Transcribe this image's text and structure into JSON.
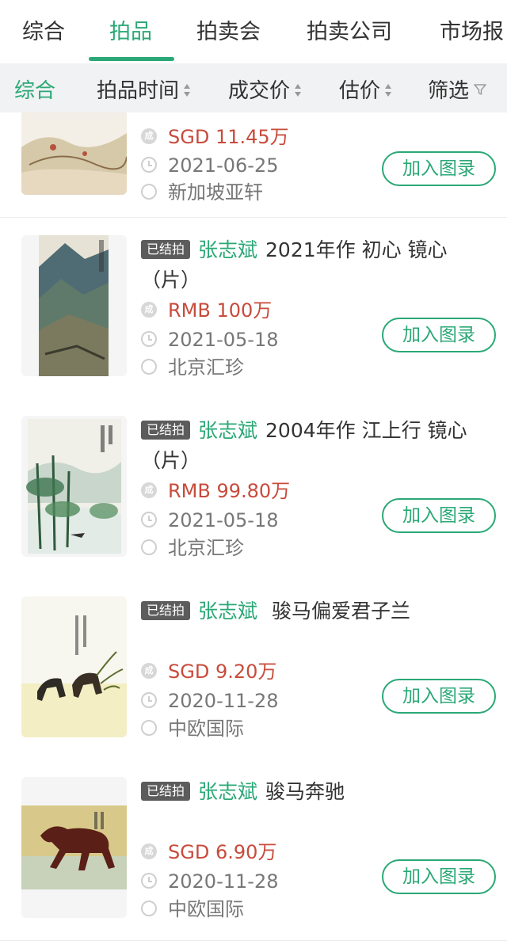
{
  "tabs": [
    "综合",
    "拍品",
    "拍卖会",
    "拍卖公司",
    "市场报"
  ],
  "filters": {
    "all": "综合",
    "time": "拍品时间",
    "deal_price": "成交价",
    "estimate": "估价",
    "filter": "筛选"
  },
  "badge_price_glyph": "成",
  "items": [
    {
      "badge": "",
      "artist": "",
      "title": "",
      "price": "SGD 11.45万",
      "date": "2021-06-25",
      "house": "新加坡亚轩",
      "button": "加入图录"
    },
    {
      "badge": "已结拍",
      "artist": "张志斌",
      "title": "2021年作 初心 镜心（片）",
      "price": "RMB 100万",
      "date": "2021-05-18",
      "house": "北京汇珍",
      "button": "加入图录"
    },
    {
      "badge": "已结拍",
      "artist": "张志斌",
      "title": "2004年作 江上行 镜心（片）",
      "price": "RMB 99.80万",
      "date": "2021-05-18",
      "house": "北京汇珍",
      "button": "加入图录"
    },
    {
      "badge": "已结拍",
      "artist": "张志斌",
      "title": " 骏马偏爱君子兰",
      "price": "SGD 9.20万",
      "date": "2020-11-28",
      "house": "中欧国际",
      "button": "加入图录"
    },
    {
      "badge": "已结拍",
      "artist": "张志斌",
      "title": "骏马奔驰",
      "price": "SGD 6.90万",
      "date": "2020-11-28",
      "house": "中欧国际",
      "button": "加入图录"
    }
  ],
  "colors": {
    "accent": "#2aa876",
    "price": "#c84b3c",
    "badge_bg": "#5c5c5c"
  }
}
